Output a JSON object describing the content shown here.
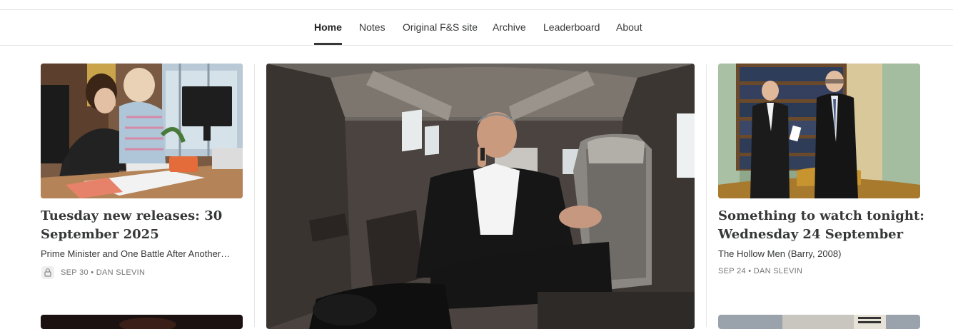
{
  "nav": {
    "items": [
      {
        "label": "Home",
        "active": true
      },
      {
        "label": "Notes",
        "active": false
      },
      {
        "label": "Original F&S site",
        "active": false
      },
      {
        "label": "Archive",
        "active": false
      },
      {
        "label": "Leaderboard",
        "active": false
      },
      {
        "label": "About",
        "active": false
      }
    ]
  },
  "posts": {
    "left": {
      "title": "Tuesday new releases: 30 September 2025",
      "subtitle": "Prime Minister and One Battle After Another…",
      "date": "SEP 30",
      "author": "DAN SLEVIN",
      "locked": true,
      "image": "photo-woman-with-toddler-at-desk"
    },
    "center": {
      "image": "photo-man-on-phone-in-vehicle"
    },
    "right": {
      "title": "Something to watch tonight: Wednesday 24 September",
      "subtitle": "The Hollow Men (Barry, 2008)",
      "date": "SEP 24",
      "author": "DAN SLEVIN",
      "image": "photo-two-men-in-library"
    }
  },
  "meta_separator": "•",
  "colors": {
    "text": "#363737",
    "muted": "#757575",
    "border": "#e6e6e6"
  }
}
